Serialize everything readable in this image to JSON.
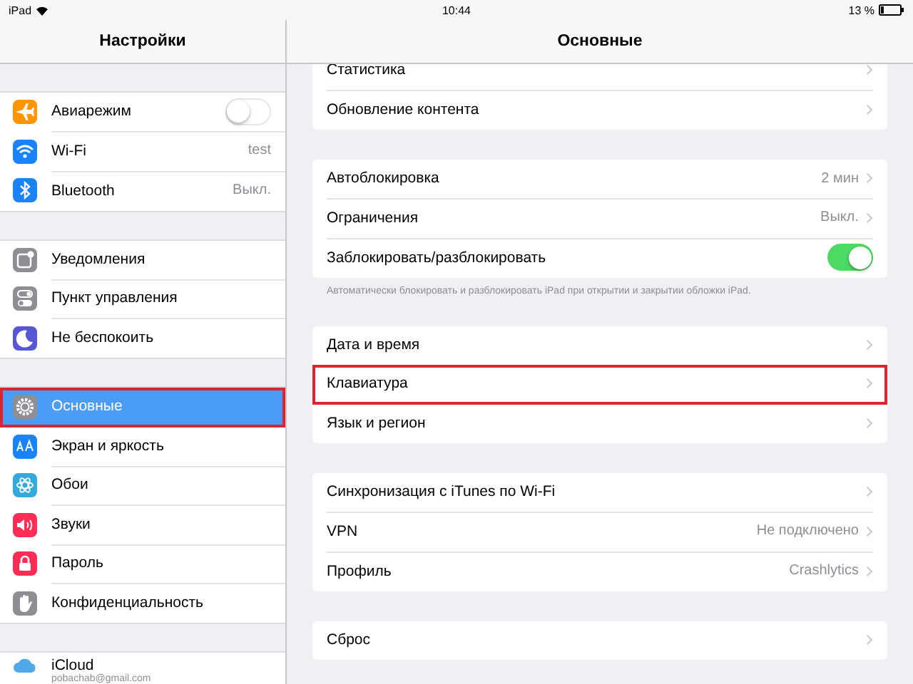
{
  "status_bar": {
    "device": "iPad",
    "time": "10:44",
    "battery": "13 %"
  },
  "sidebar": {
    "title": "Настройки",
    "groups": [
      {
        "items": [
          {
            "kind": "toggle",
            "label": "Авиарежим",
            "on": false,
            "selected": false,
            "highlighted": false
          },
          {
            "kind": "value",
            "label": "Wi-Fi",
            "value": "test",
            "selected": false,
            "highlighted": false
          },
          {
            "kind": "value",
            "label": "Bluetooth",
            "value": "Выкл.",
            "selected": false,
            "highlighted": false
          }
        ]
      },
      {
        "items": [
          {
            "kind": "plain",
            "label": "Уведомления",
            "selected": false,
            "highlighted": false
          },
          {
            "kind": "plain",
            "label": "Пункт управления",
            "selected": false,
            "highlighted": false
          },
          {
            "kind": "plain",
            "label": "Не беспокоить",
            "selected": false,
            "highlighted": false
          }
        ]
      },
      {
        "items": [
          {
            "kind": "plain",
            "label": "Основные",
            "selected": true,
            "highlighted": true
          },
          {
            "kind": "plain",
            "label": "Экран и яркость",
            "selected": false,
            "highlighted": false
          },
          {
            "kind": "plain",
            "label": "Обои",
            "selected": false,
            "highlighted": false
          },
          {
            "kind": "plain",
            "label": "Звуки",
            "selected": false,
            "highlighted": false
          },
          {
            "kind": "plain",
            "label": "Пароль",
            "selected": false,
            "highlighted": false
          },
          {
            "kind": "plain",
            "label": "Конфиденциальность",
            "selected": false,
            "highlighted": false
          }
        ]
      },
      {
        "items": [
          {
            "kind": "account",
            "label": "iCloud",
            "subtitle": "pobachab@gmail.com",
            "selected": false,
            "highlighted": false
          }
        ]
      }
    ]
  },
  "detail": {
    "title": "Основные",
    "groups": [
      {
        "rows": [
          {
            "kind": "link",
            "label": "Статистика",
            "highlighted": false
          },
          {
            "kind": "link",
            "label": "Обновление контента",
            "highlighted": false
          }
        ]
      },
      {
        "rows": [
          {
            "kind": "link",
            "label": "Автоблокировка",
            "value": "2 мин",
            "highlighted": false
          },
          {
            "kind": "link",
            "label": "Ограничения",
            "value": "Выкл.",
            "highlighted": false
          },
          {
            "kind": "toggle",
            "label": "Заблокировать/разблокировать",
            "on": true,
            "highlighted": false
          }
        ],
        "footnote": "Автоматически блокировать и разблокировать iPad при открытии и закрытии обложки iPad."
      },
      {
        "rows": [
          {
            "kind": "link",
            "label": "Дата и время",
            "highlighted": false
          },
          {
            "kind": "link",
            "label": "Клавиатура",
            "highlighted": true
          },
          {
            "kind": "link",
            "label": "Язык и регион",
            "highlighted": false
          }
        ]
      },
      {
        "rows": [
          {
            "kind": "link",
            "label": "Синхронизация с iTunes по Wi-Fi",
            "highlighted": false
          },
          {
            "kind": "link",
            "label": "VPN",
            "value": "Не подключено",
            "highlighted": false
          },
          {
            "kind": "link",
            "label": "Профиль",
            "value": "Crashlytics",
            "highlighted": false
          }
        ]
      },
      {
        "rows": [
          {
            "kind": "link",
            "label": "Сброс",
            "highlighted": false
          }
        ]
      }
    ]
  }
}
